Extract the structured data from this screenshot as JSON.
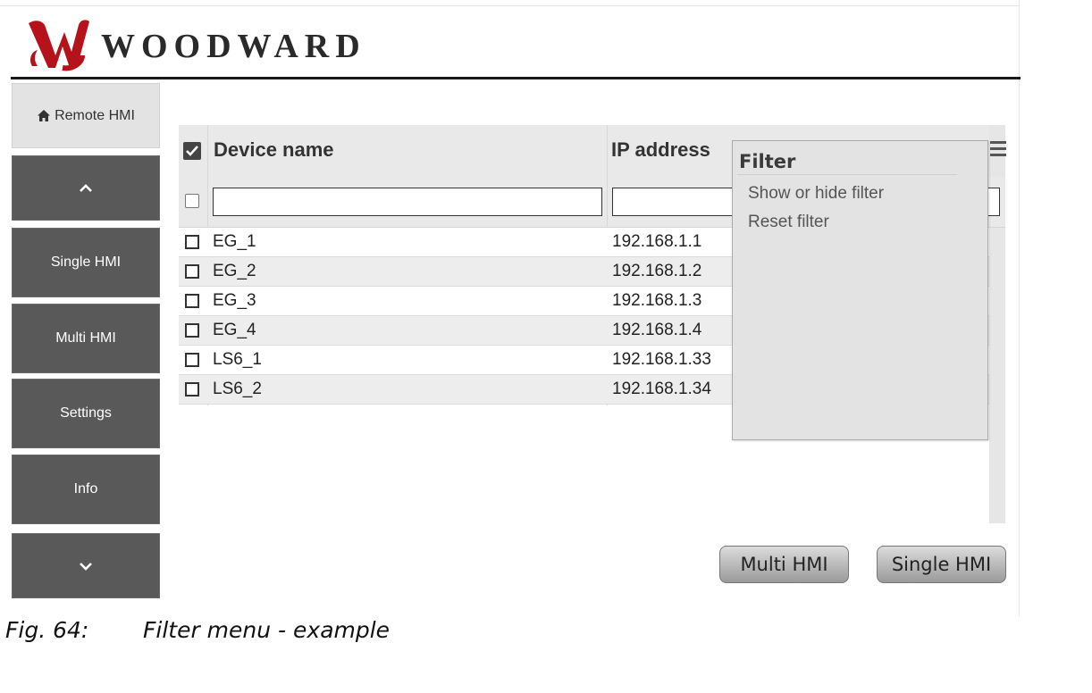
{
  "header": {
    "brand": "WOODWARD",
    "logo_icon": "woodward-logo-icon",
    "logo_color": "#b5121b"
  },
  "sidebar": {
    "home_label": "Remote HMI",
    "home_icon": "home-icon",
    "up_icon": "chevron-up-icon",
    "down_icon": "chevron-down-icon",
    "items": [
      {
        "label": "Single HMI"
      },
      {
        "label": "Multi HMI"
      },
      {
        "label": "Settings"
      },
      {
        "label": "Info"
      }
    ]
  },
  "table": {
    "columns": [
      "Device name",
      "IP address"
    ],
    "menu_icon": "menu-icon",
    "rows": [
      {
        "name": "EG_1",
        "ip": "192.168.1.1"
      },
      {
        "name": "EG_2",
        "ip": "192.168.1.2"
      },
      {
        "name": "EG_3",
        "ip": "192.168.1.3"
      },
      {
        "name": "EG_4",
        "ip": "192.168.1.4"
      },
      {
        "name": "LS6_1",
        "ip": "192.168.1.33"
      },
      {
        "name": "LS6_2",
        "ip": "192.168.1.34"
      }
    ]
  },
  "filter_menu": {
    "title": "Filter",
    "items": [
      "Show or hide filter",
      "Reset filter"
    ]
  },
  "actions": {
    "multi": "Multi HMI",
    "single": "Single HMI"
  },
  "caption": {
    "fig": "Fig. 64:",
    "text": "Filter menu - example"
  }
}
